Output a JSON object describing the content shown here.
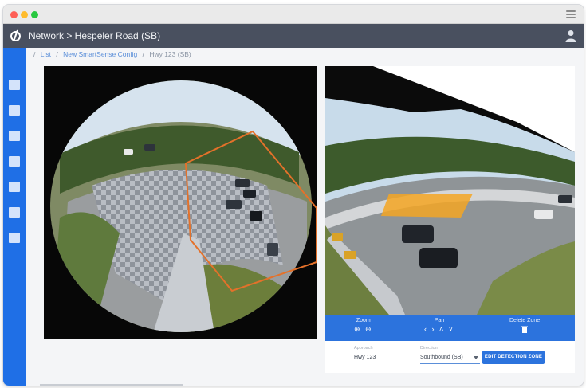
{
  "window": {
    "menu_icon": "hamburger-menu-icon"
  },
  "appbar": {
    "logo_icon": "brand-logo-icon",
    "title": "Network > Hespeler Road (SB)",
    "user_icon": "user-icon"
  },
  "sidebar": {
    "items": [
      {
        "icon": "nav-square-icon"
      },
      {
        "icon": "nav-square-icon"
      },
      {
        "icon": "nav-square-icon"
      },
      {
        "icon": "nav-square-icon"
      },
      {
        "icon": "nav-square-icon"
      },
      {
        "icon": "nav-square-icon"
      },
      {
        "icon": "nav-square-icon"
      }
    ]
  },
  "breadcrumb": {
    "items": [
      "List",
      "New SmartSense Config",
      "Hwy 123 (SB)"
    ],
    "separator": "/"
  },
  "controls": {
    "zoom_label": "Zoom",
    "pan_label": "Pan",
    "delete_label": "Delete Zone",
    "zoom_icons": "⊕ ⊖",
    "pan_icons": "‹ › ˄ ˅",
    "delete_icon": "trash-icon"
  },
  "form": {
    "approach_label": "Approach",
    "approach_value": "Hwy 123",
    "direction_label": "Direction",
    "direction_value": "Southbound (SB)",
    "edit_button": "EDIT DETECTION ZONE"
  },
  "colors": {
    "accent": "#2c73dd",
    "sidebar": "#1f6fe6",
    "appbar": "#49505f",
    "zone_outline": "#e4712a",
    "zone_fill": "#f5a623"
  }
}
